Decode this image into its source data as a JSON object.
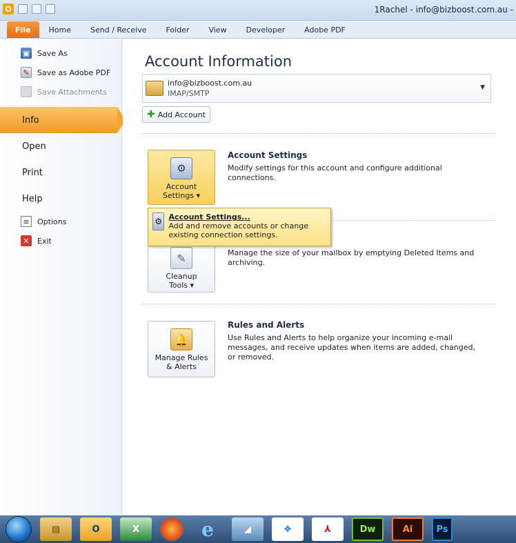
{
  "window": {
    "title": "1Rachel - info@bizboost.com.au -",
    "qat_icons": [
      "outlook-icon",
      "send-receive-icon",
      "undo-icon",
      "customize-icon"
    ]
  },
  "ribbon": {
    "tabs": [
      "File",
      "Home",
      "Send / Receive",
      "Folder",
      "View",
      "Developer",
      "Adobe PDF"
    ]
  },
  "backstage": {
    "commands_top": [
      {
        "label": "Save As",
        "icon": "save-as-icon",
        "enabled": true
      },
      {
        "label": "Save as Adobe PDF",
        "icon": "pdf-icon",
        "enabled": true
      },
      {
        "label": "Save Attachments",
        "icon": "attachments-icon",
        "enabled": false
      }
    ],
    "tabs": [
      "Info",
      "Open",
      "Print",
      "Help"
    ],
    "active_tab": "Info",
    "commands_bottom": [
      {
        "label": "Options",
        "icon": "options-icon"
      },
      {
        "label": "Exit",
        "icon": "exit-icon"
      }
    ]
  },
  "info": {
    "title": "Account Information",
    "account": {
      "email": "info@bizboost.com.au",
      "type": "IMAP/SMTP"
    },
    "add_account_label": "Add Account",
    "sections": [
      {
        "button_label_1": "Account",
        "button_label_2": "Settings ▾",
        "title": "Account Settings",
        "desc": "Modify settings for this account and configure additional connections."
      },
      {
        "button_label_1": "Cleanup",
        "button_label_2": "Tools ▾",
        "title": "",
        "desc": "Manage the size of your mailbox by emptying Deleted Items and archiving."
      },
      {
        "button_label_1": "Manage Rules",
        "button_label_2": "& Alerts",
        "title": "Rules and Alerts",
        "desc": "Use Rules and Alerts to help organize your incoming e-mail messages, and receive updates when items are added, changed, or removed."
      }
    ],
    "dropdown": {
      "title": "Account Settings...",
      "desc": "Add and remove accounts or change existing connection settings."
    }
  },
  "taskbar": {
    "items": [
      "start-button",
      "windows-explorer",
      "outlook",
      "excel",
      "firefox",
      "internet-explorer",
      "snipping-tool",
      "dropbox",
      "adobe-reader",
      "dreamweaver",
      "illustrator",
      "photoshop"
    ],
    "labels": {
      "dw": "Dw",
      "ai": "Ai",
      "ps": "Ps"
    }
  },
  "colors": {
    "file_tab": "#e2711b",
    "active_nav": "#f39a25",
    "hover_button": "#f8cf5c"
  }
}
